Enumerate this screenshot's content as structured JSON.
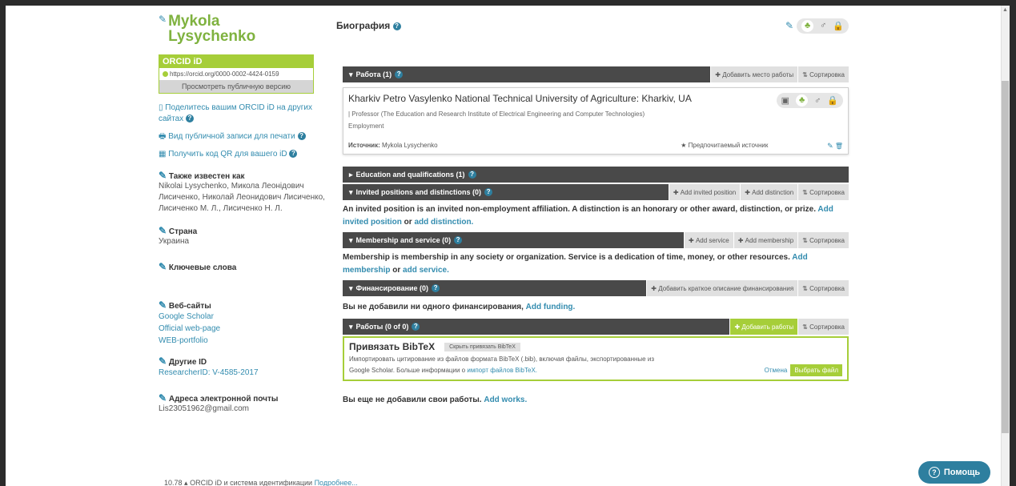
{
  "profile": {
    "name_first": "Mykola",
    "name_last": "Lysychenko",
    "orcid_header": "ORCID iD",
    "orcid_url": "https://orcid.org/0000-0002-4424-0159",
    "view_public": "Просмотреть публичную версию",
    "share_link": "Поделитесь вашим ORCID iD на других сайтах",
    "print_link": "Вид публичной записи для печати",
    "qr_link": "Получить код QR для вашего iD"
  },
  "sections": {
    "also_known_title": "Также известен как",
    "also_known_value": "Nikolai Lysychenko, Микола Леонідович Лисиченко, Николай Леонидович Лисиченко, Лисиченко М. Л., Лисиченко Н. Л.",
    "country_title": "Страна",
    "country_value": "Украина",
    "keywords_title": "Ключевые слова",
    "websites_title": "Веб-сайты",
    "websites": [
      "Google Scholar",
      "Official web-page",
      "WEB-portfolio"
    ],
    "other_ids_title": "Другие ID",
    "other_ids_value": "ResearcherID: V-4585-2017",
    "emails_title": "Адреса электронной почты",
    "email_value": "Lis23051962@gmail.com"
  },
  "main": {
    "biography_title": "Биография",
    "employment": {
      "title": "Работа (1)",
      "add_btn": "Добавить место работы",
      "sort_btn": "Сортировка",
      "card_title": "Kharkiv Petro Vasylenko National Technical University of Agriculture: Kharkiv, UA",
      "card_role": "| Professor (The Education and Research Institute of Electrical Engineering and Computer Technologies)",
      "card_type": "Employment",
      "source_label": "Источник:",
      "source_value": "Mykola Lysychenko",
      "preferred": "Предпочитаемый источник"
    },
    "education": {
      "title": "Education and qualifications (1)"
    },
    "invited": {
      "title": "Invited positions and distinctions (0)",
      "add_position": "Add invited position",
      "add_distinction": "Add distinction",
      "sort_btn": "Сортировка",
      "info_text": "An invited position is an invited non-employment affiliation. A distinction is an honorary or other award, distinction, or prize.",
      "info_link1": "Add invited position",
      "info_or": "or",
      "info_link2": "add distinction."
    },
    "membership": {
      "title": "Membership and service (0)",
      "add_service": "Add service",
      "add_membership": "Add membership",
      "sort_btn": "Сортировка",
      "info_text": "Membership is membership in any society or organization. Service is a dedication of time, money, or other resources.",
      "info_link1": "Add membership",
      "info_or": "or",
      "info_link2": "add service."
    },
    "funding": {
      "title": "Финансирование (0)",
      "add_btn": "Добавить краткое описание финансирования",
      "sort_btn": "Сортировка",
      "info_text": "Вы не добавили ни одного финансирования,",
      "info_link": "Add funding."
    },
    "works": {
      "title": "Работы (0 of 0)",
      "add_btn": "Добавить работы",
      "sort_btn": "Сортировка",
      "bib_title": "Привязать BibTeX",
      "bib_hide": "Скрыть привязать BibTeX",
      "bib_text1": "Импортировать цитирование из файлов формата BibTeX (.bib), включая файлы, экспортированные из",
      "bib_text2": "Google Scholar. Больше информации о",
      "bib_link": "импорт файлов BibTeX.",
      "cancel": "Отмена",
      "choose": "Выбрать файл",
      "info_text": "Вы еще не добавили свои работы.",
      "info_link": "Add works."
    }
  },
  "footer": {
    "version": "10.78",
    "text": "ORCID iD и система идентификации",
    "link": "Подробнее..."
  },
  "help_button": "Помощь",
  "colors": {
    "orcid_green": "#a6ce39",
    "bar_dark": "#494949",
    "link_blue": "#338caf"
  }
}
